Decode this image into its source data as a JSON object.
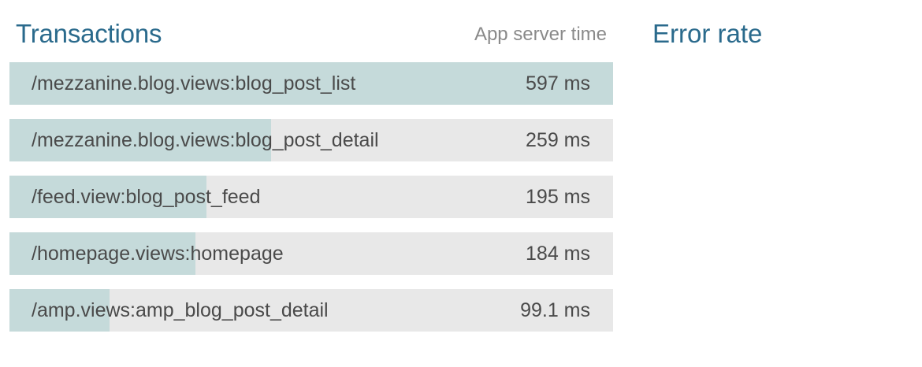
{
  "transactions": {
    "title": "Transactions",
    "column_label": "App server time",
    "rows": [
      {
        "name": "/mezzanine.blog.views:blog_post_list",
        "time": "597 ms",
        "value_ms": 597
      },
      {
        "name": "/mezzanine.blog.views:blog_post_detail",
        "time": "259 ms",
        "value_ms": 259
      },
      {
        "name": "/feed.view:blog_post_feed",
        "time": "195 ms",
        "value_ms": 195
      },
      {
        "name": "/homepage.views:homepage",
        "time": "184 ms",
        "value_ms": 184
      },
      {
        "name": "/amp.views:amp_blog_post_detail",
        "time": "99.1 ms",
        "value_ms": 99.1
      }
    ]
  },
  "error_rate": {
    "title": "Error rate"
  },
  "colors": {
    "title": "#2a6a8c",
    "bar_fill": "#c5dada",
    "bar_track": "#e8e8e8",
    "text": "#4a4a4a",
    "muted": "#8a8a8a"
  }
}
